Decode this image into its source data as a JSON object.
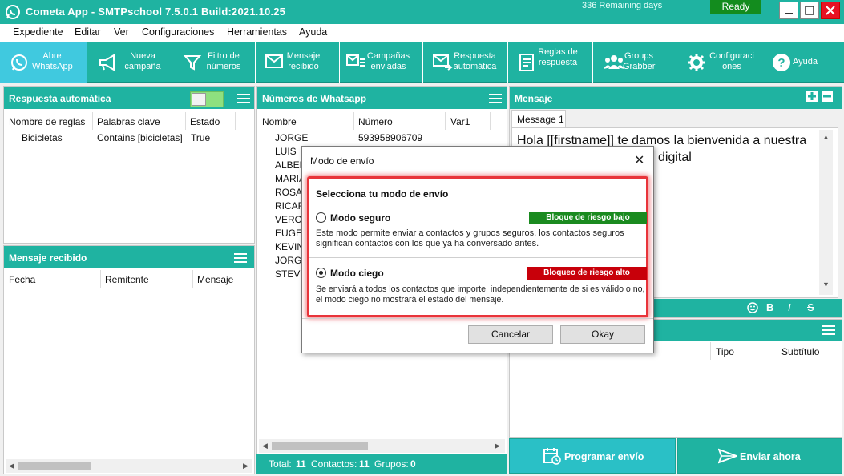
{
  "window": {
    "title": "Cometa App - SMTPschool 7.5.0.1 Build:2021.10.25",
    "remaining": "336 Remaining days",
    "status": "Ready",
    "accent": "#1fb3a1"
  },
  "menu": [
    "Expediente",
    "Editar",
    "Ver",
    "Configuraciones",
    "Herramientas",
    "Ayuda"
  ],
  "toolbar": [
    {
      "line1": "Abre",
      "line2": "WhatsApp",
      "icon": "whatsapp-icon"
    },
    {
      "line1": "Nueva",
      "line2": "campaña",
      "icon": "megaphone-icon"
    },
    {
      "line1": "Filtro de",
      "line2": "números",
      "icon": "funnel-icon"
    },
    {
      "line1": "Mensaje",
      "line2": "recibido",
      "icon": "mail-in-icon"
    },
    {
      "line1": "Campañas",
      "line2": "enviadas",
      "icon": "mail-list-icon"
    },
    {
      "line1": "Respuesta",
      "line2": "automática",
      "icon": "mail-reply-icon"
    },
    {
      "line1": "Reglas de",
      "line2": "respuesta",
      "icon": "document-icon"
    },
    {
      "line1": "Groups",
      "line2": "Grabber",
      "icon": "group-icon"
    },
    {
      "line1": "Configuraci",
      "line2": "ones",
      "icon": "gear-icon"
    },
    {
      "line1": "Ayuda",
      "line2": "",
      "icon": "help-icon"
    }
  ],
  "auto_reply": {
    "title": "Respuesta automática",
    "columns": [
      "Nombre de reglas",
      "Palabras clave",
      "Estado"
    ],
    "rows": [
      [
        "Bicicletas",
        "Contains [bicicletas]",
        "True"
      ]
    ]
  },
  "received": {
    "title": "Mensaje recibido",
    "columns": [
      "Fecha",
      "Remitente",
      "Mensaje"
    ]
  },
  "numbers": {
    "title": "Números de Whatsapp",
    "columns": [
      "Nombre",
      "Número",
      "Var1"
    ],
    "rows": [
      [
        "JORGE",
        "593958906709"
      ],
      [
        "LUIS",
        ""
      ],
      [
        "ALBER",
        ""
      ],
      [
        "MARIA",
        ""
      ],
      [
        "ROSA",
        ""
      ],
      [
        "RICARI",
        ""
      ],
      [
        "VERON",
        ""
      ],
      [
        "EUGEN",
        ""
      ],
      [
        "KEVIN",
        ""
      ],
      [
        "JORGE",
        ""
      ],
      [
        "STEVE",
        ""
      ]
    ],
    "totals": {
      "total_label": "Total:",
      "total": "11",
      "contacts_label": "Contactos:",
      "contacts": "11",
      "groups_label": "Grupos:",
      "groups": "0"
    }
  },
  "message": {
    "title": "Mensaje",
    "tab": "Message 1",
    "text_line1": "Hola [[firstname]] te damos la bienvenida a nuestra",
    "text_line2": "digital",
    "format": {
      "bold": "B",
      "italic": "I",
      "strike": "S"
    }
  },
  "attachments": {
    "columns": [
      "Tipo",
      "Subtítulo"
    ]
  },
  "actions": {
    "schedule": "Programar envío",
    "send_now": "Enviar ahora"
  },
  "modal": {
    "title": "Modo de envío",
    "heading": "Selecciona tu modo de envío",
    "safe": {
      "label": "Modo seguro",
      "badge": "Bloque de riesgo bajo",
      "badge_color": "#1a8a1f",
      "desc_line1": "Este modo permite enviar a contactos y grupos seguros, los contactos seguros",
      "desc_line2": "significan contactos con los que ya ha conversado antes."
    },
    "blind": {
      "label": "Modo ciego",
      "badge": "Bloqueo de riesgo alto",
      "badge_color": "#c8000a",
      "desc_line1": "Se enviará a todos los contactos que importe, independientemente de si es válido o no,",
      "desc_line2": "el modo ciego no mostrará el estado del mensaje."
    },
    "cancel": "Cancelar",
    "ok": "Okay"
  }
}
